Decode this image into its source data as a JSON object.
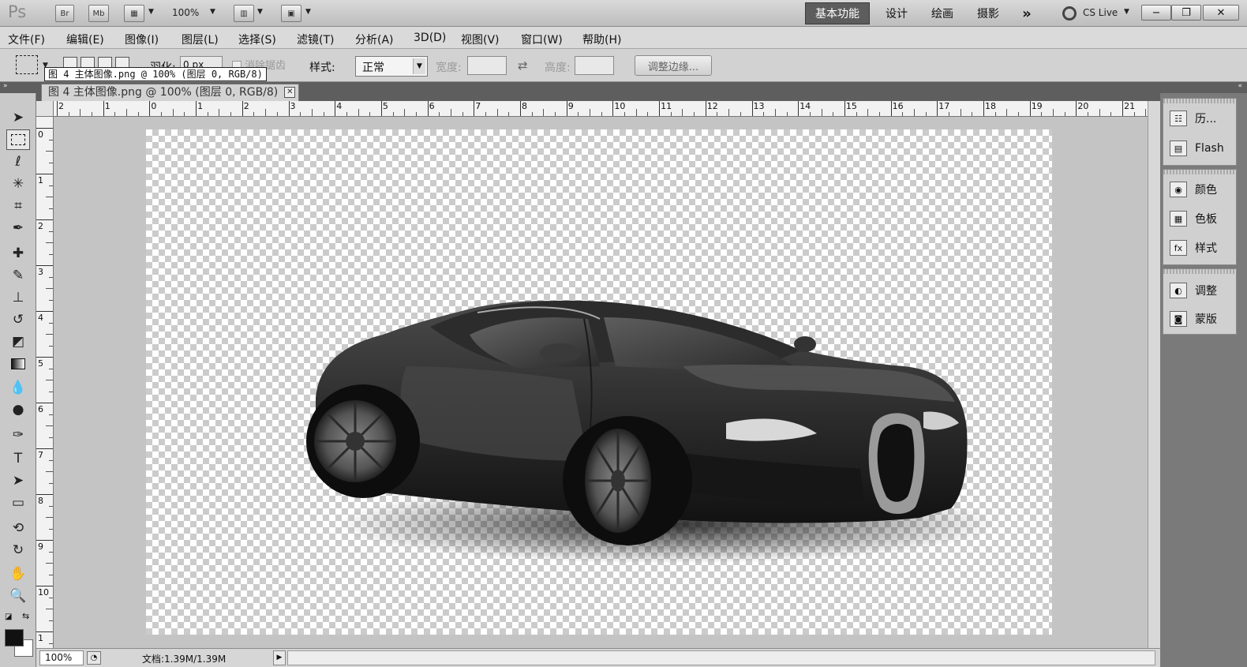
{
  "appbar": {
    "logo": "Ps",
    "bridge_label": "Br",
    "mini_bridge_label": "Mb",
    "zoom": "100%",
    "workspaces": [
      "基本功能",
      "设计",
      "绘画",
      "摄影"
    ],
    "active_workspace": "基本功能",
    "more": "»",
    "cs_live": "CS Live"
  },
  "menu": {
    "items": [
      "文件(F)",
      "编辑(E)",
      "图像(I)",
      "图层(L)",
      "选择(S)",
      "滤镜(T)",
      "分析(A)",
      "3D(D)",
      "视图(V)",
      "窗口(W)",
      "帮助(H)"
    ]
  },
  "options": {
    "feather_label": "羽化:",
    "feather_value": "0 px",
    "antialias_label": "消除锯齿",
    "style_label": "样式:",
    "style_value": "正常",
    "width_label": "宽度:",
    "height_label": "高度:",
    "refine_edge": "调整边缘..."
  },
  "tooltip": "图 4  主体图像.png @ 100% (图层 0, RGB/8)",
  "document": {
    "tab_title": "图 4  主体图像.png @ 100% (图层 0, RGB/8)",
    "zoom_status": "100%",
    "doc_info": "文档:1.39M/1.39M"
  },
  "rulers": {
    "h_labels": [
      "2",
      "1",
      "0",
      "1",
      "2",
      "3",
      "4",
      "5",
      "6",
      "7",
      "8",
      "9",
      "10",
      "11",
      "12",
      "13",
      "14",
      "15",
      "16",
      "17",
      "18",
      "19",
      "20",
      "21"
    ],
    "v_labels": [
      "0",
      "1",
      "2",
      "3",
      "4",
      "5",
      "6",
      "7",
      "8",
      "9",
      "10",
      "1"
    ]
  },
  "panels": {
    "group1": [
      "历...",
      "Flash"
    ],
    "group2": [
      "颜色",
      "色板",
      "样式"
    ],
    "group3": [
      "调整",
      "蒙版"
    ]
  },
  "colors": {
    "workspace_active": "#5d5d5d",
    "foreground": "#111111",
    "background": "#ffffff"
  }
}
